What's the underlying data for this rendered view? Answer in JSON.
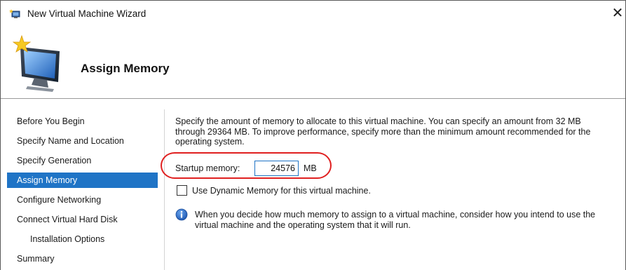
{
  "window": {
    "title": "New Virtual Machine Wizard",
    "close_glyph": "✕",
    "app_icon": "virtual-machine-wizard-icon"
  },
  "header": {
    "page_title": "Assign Memory",
    "hero_icon": "monitor-with-star-icon"
  },
  "nav": {
    "items": [
      {
        "label": "Before You Begin",
        "selected": false
      },
      {
        "label": "Specify Name and Location",
        "selected": false
      },
      {
        "label": "Specify Generation",
        "selected": false
      },
      {
        "label": "Assign Memory",
        "selected": true
      },
      {
        "label": "Configure Networking",
        "selected": false
      },
      {
        "label": "Connect Virtual Hard Disk",
        "selected": false
      },
      {
        "label": "Installation Options",
        "selected": false,
        "sub": true
      },
      {
        "label": "Summary",
        "selected": false
      }
    ]
  },
  "main": {
    "description": "Specify the amount of memory to allocate to this virtual machine. You can specify an amount from 32 MB through 29364 MB. To improve performance, specify more than the minimum amount recommended for the operating system.",
    "startup_memory_label": "Startup memory:",
    "startup_memory_value": "24576",
    "startup_memory_unit": "MB",
    "dynamic_memory_label": "Use Dynamic Memory for this virtual machine.",
    "dynamic_memory_checked": false,
    "info_text": "When you decide how much memory to assign to a virtual machine, consider how you intend to use the virtual machine and the operating system that it will run.",
    "info_icon": "info-icon"
  },
  "colors": {
    "selection": "#1f74c6",
    "highlight_annotation": "#e02020"
  }
}
